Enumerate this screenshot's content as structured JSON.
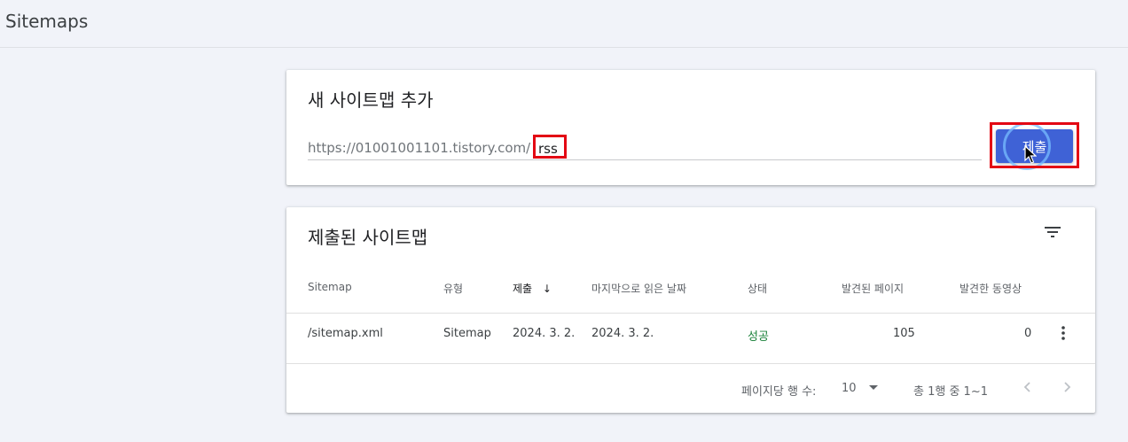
{
  "header": {
    "title": "Sitemaps"
  },
  "add_card": {
    "title": "새 사이트맵 추가",
    "url_prefix": "https://01001001101.tistory.com/",
    "input_value": "rss",
    "submit_label": "제출"
  },
  "list_card": {
    "title": "제출된 사이트맵",
    "columns": [
      "Sitemap",
      "유형",
      "제출",
      "마지막으로 읽은 날짜",
      "상태",
      "발견된 페이지",
      "발견한 동영상"
    ],
    "sort_indicator": "↓",
    "rows": [
      {
        "sitemap": "/sitemap.xml",
        "type": "Sitemap",
        "submitted": "2024. 3. 2.",
        "last_read": "2024. 3. 2.",
        "status": "성공",
        "pages": "105",
        "videos": "0"
      }
    ],
    "pagination": {
      "rows_per_page_label": "페이지당 행 수:",
      "rows_per_page_value": "10",
      "range_label": "총 1행 중 1~1"
    }
  },
  "colors": {
    "accent": "#3f62d6",
    "success": "#188038",
    "highlight": "#e30613"
  }
}
